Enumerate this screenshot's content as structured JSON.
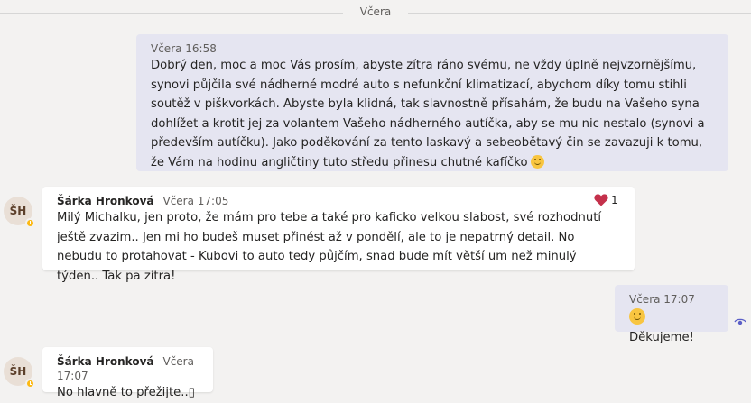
{
  "divider_label": "Včera",
  "messages": [
    {
      "timestamp": "Včera 16:58",
      "text": "Dobrý den, moc a moc Vás prosím, abyste zítra ráno svému, ne vždy úplně nejvzornějšímu, synovi půjčila své nádherné modré auto s nefunkční klimatizací, abychom díky tomu stihli soutěž v piškvorkách. Abyste byla klidná, tak slavnostně přísahám, že budu na Vašeho syna dohlížet a krotit jej za volantem Vašeho nádherného autíčka, aby se mu nic nestalo (synovi a především autíčku). Jako poděkování za tento laskavý a sebeobětavý čin se zavazuji k tomu, že Vám na hodinu angličtiny tuto středu přinesu chutné kafíčko",
      "emoji": "smile-emoji"
    },
    {
      "author": "Šárka Hronková",
      "timestamp": "Včera 17:05",
      "avatar_initials": "ŠH",
      "text": "Milý Michalku, jen proto, že mám pro tebe a také pro kaficko velkou slabost, své rozhodnutí ještě zvazim.. Jen mi ho budeš muset přinést až v pondělí, ale to je nepatrný detail. No nebudu to protahovat - Kubovi to auto tedy půjčím, snad bude mít větší um než minulý týden.. Tak pa zítra!",
      "reaction_icon": "heart-icon",
      "reaction_count": "1"
    },
    {
      "timestamp": "Včera 17:07",
      "emoji": "smile-emoji",
      "text": "Děkujeme!",
      "read_icon": "eye-icon"
    },
    {
      "author": "Šárka Hronková",
      "timestamp": "Včera 17:07",
      "avatar_initials": "ŠH",
      "text": "No hlavně to přežijte..",
      "trailing_glyph": "▯"
    }
  ],
  "colors": {
    "background": "#f3f2f1",
    "my_bubble": "#e5e5f1",
    "other_bubble": "#ffffff",
    "presence_away": "#fdb913",
    "heart": "#c4314b"
  }
}
